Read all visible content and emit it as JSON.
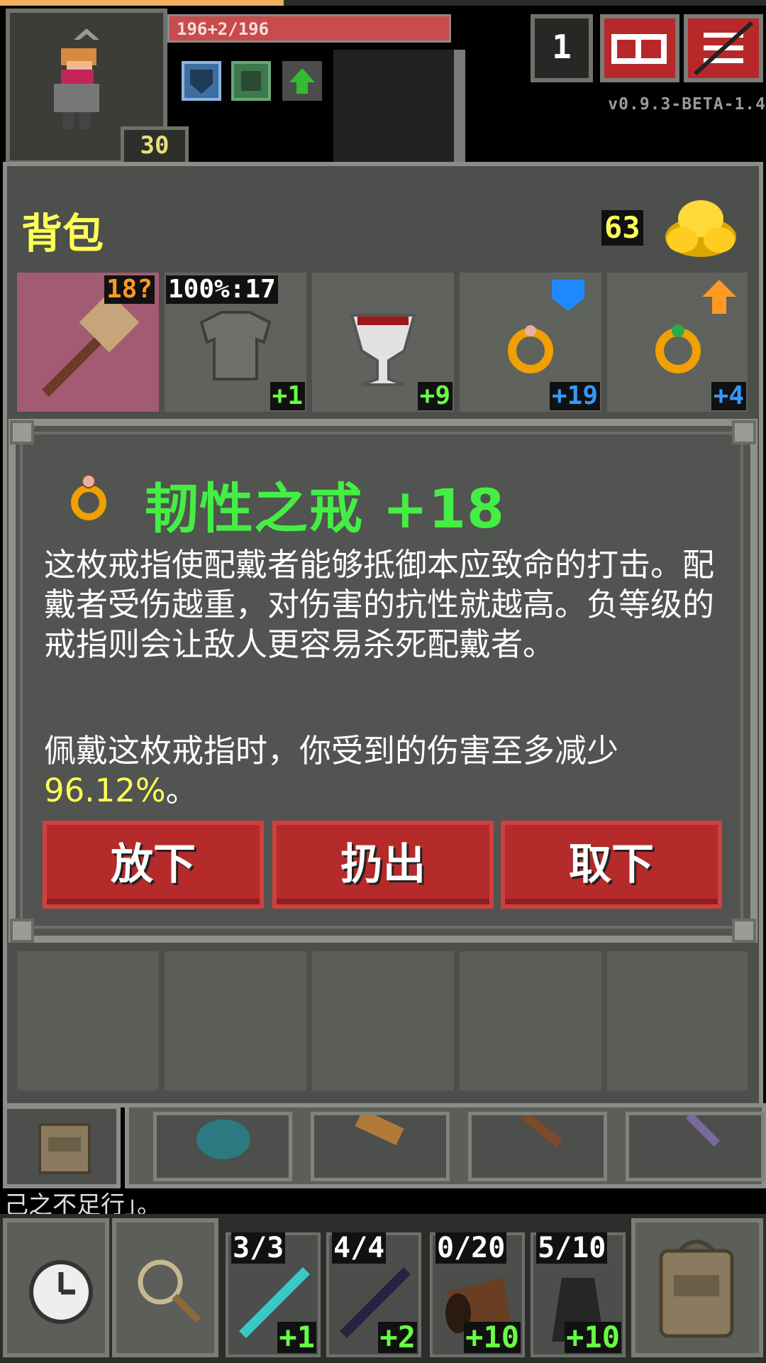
{
  "hud": {
    "hp_text": "196+2/196",
    "hp_fraction": 1.0,
    "xp_fraction": 0.37,
    "hero_level": "30",
    "depth": "1",
    "version": "v0.9.3-BETA-1.4",
    "buffs": [
      "shield-buff-icon",
      "armor-buff-icon",
      "levitation-buff-icon"
    ],
    "buttons": [
      "journal-button",
      "menu-button"
    ]
  },
  "backpack": {
    "title": "背包",
    "gold": "63",
    "equipped": [
      {
        "name": "war-hammer",
        "tag_left": "18?",
        "tag_color": "#ff9922",
        "selected": true
      },
      {
        "name": "plate-armor",
        "tag_left": "100%:17",
        "tag_color": "#ffffff",
        "level": "+1",
        "level_color": "#66ff44"
      },
      {
        "name": "artifact-chalice",
        "level": "+9",
        "level_color": "#66ff44"
      },
      {
        "name": "ring-of-tenacity",
        "level": "+19",
        "level_color": "#3399ff",
        "badge": "shield"
      },
      {
        "name": "ring-emerald",
        "level": "+4",
        "level_color": "#3399ff",
        "badge": "arrow-up"
      }
    ]
  },
  "dialog": {
    "title": "韧性之戒 +18",
    "description": "这枚戒指使配戴者能够抵御本应致命的打击。配戴者受伤越重，对伤害的抗性就越高。负等级的戒指则会让敌人更容易杀死配戴者。",
    "stat_prefix": "佩戴这枚戒指时，你受到的伤害至多减少",
    "stat_value": "96.12%",
    "stat_suffix": "。",
    "buttons": {
      "drop": "放下",
      "throw": "扔出",
      "unequip": "取下"
    }
  },
  "log": {
    "fragment": "己之不足行」。"
  },
  "quickslots": [
    {
      "count": "3/3",
      "level": "+1",
      "item": "wand-frost"
    },
    {
      "count": "4/4",
      "level": "+2",
      "item": "wand-shadow"
    },
    {
      "count": "0/20",
      "level": "+10",
      "item": "horn-of-plenty"
    },
    {
      "count": "5/10",
      "level": "+10",
      "item": "cloak-of-shadows"
    }
  ]
}
